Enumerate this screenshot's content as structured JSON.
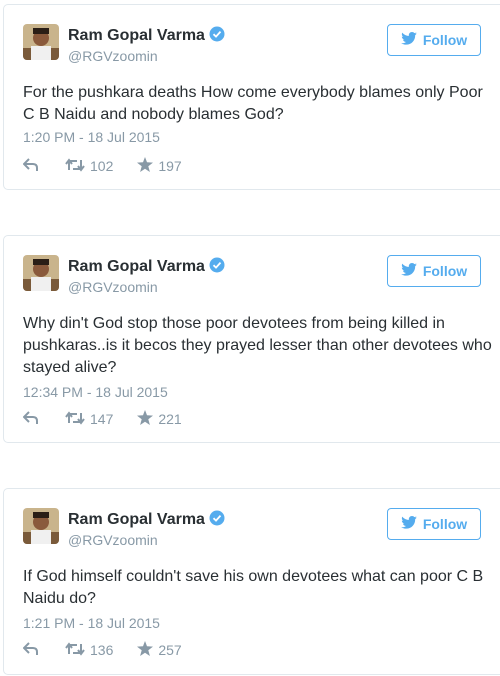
{
  "colors": {
    "accent": "#55acee",
    "text": "#292f33",
    "muted": "#8899a6",
    "border": "#e1e8ed"
  },
  "icons": {
    "reply": "reply-icon",
    "retweet": "retweet-icon",
    "favorite": "star-icon",
    "verified": "verified-badge-icon",
    "follow": "twitter-bird-icon"
  },
  "tweets": [
    {
      "name": "Ram Gopal Varma",
      "handle": "@RGVzoomin",
      "follow_label": "Follow",
      "text": "For the pushkara deaths How come everybody blames only Poor C B Naidu and nobody blames God?",
      "time": "1:20 PM - 18 Jul 2015",
      "retweets": "102",
      "favorites": "197"
    },
    {
      "name": "Ram Gopal Varma",
      "handle": "@RGVzoomin",
      "follow_label": "Follow",
      "text": "Why din't God stop those poor devotees from being killed in pushkaras..is it becos they prayed lesser than other devotees who stayed alive?",
      "time": "12:34 PM - 18 Jul 2015",
      "retweets": "147",
      "favorites": "221"
    },
    {
      "name": "Ram Gopal Varma",
      "handle": "@RGVzoomin",
      "follow_label": "Follow",
      "text": "If God himself couldn't save his own devotees what can poor C B Naidu do?",
      "time": "1:21 PM - 18 Jul 2015",
      "retweets": "136",
      "favorites": "257"
    }
  ]
}
